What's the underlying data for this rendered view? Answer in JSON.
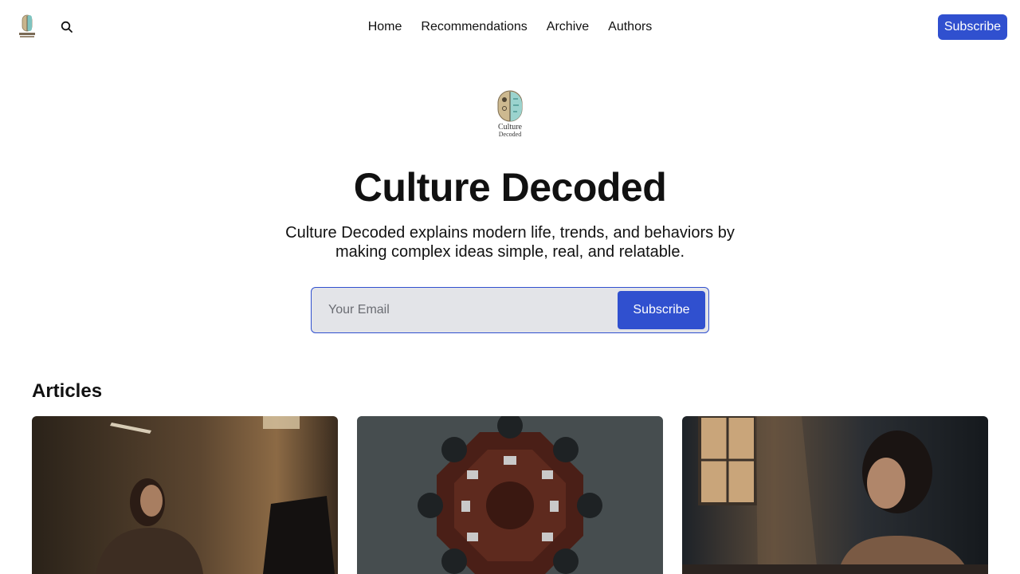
{
  "nav": {
    "logo_alt": "Culture Decoded",
    "links": [
      "Home",
      "Recommendations",
      "Archive",
      "Authors"
    ],
    "subscribe_label": "Subscribe"
  },
  "hero": {
    "logo_text_line1": "Culture",
    "logo_text_line2": "Decoded",
    "title": "Culture Decoded",
    "description": "Culture Decoded explains modern life, trends, and behaviors by making complex ideas simple, real, and relatable.",
    "email_placeholder": "Your Email",
    "subscribe_label": "Subscribe"
  },
  "articles": {
    "heading": "Articles"
  },
  "colors": {
    "accent": "#3050cf",
    "input_bg": "#e3e4e8"
  },
  "icons": [
    "search-icon",
    "culture-decoded-logo"
  ]
}
